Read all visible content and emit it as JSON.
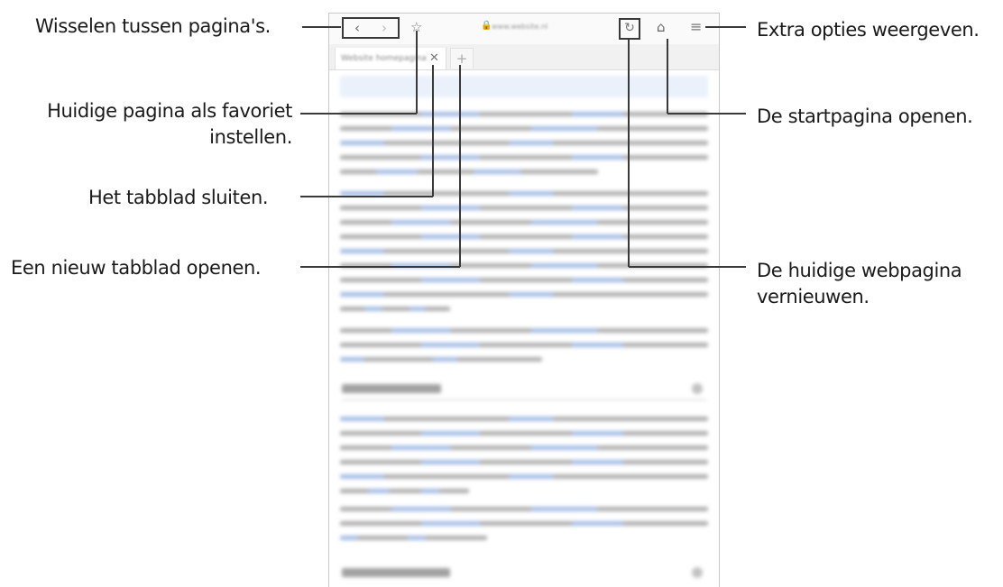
{
  "callouts": {
    "switch_pages": "Wisselen tussen pagina's.",
    "bookmark_line1": "Huidige pagina als favoriet",
    "bookmark_line2": "instellen.",
    "close_tab": "Het tabblad sluiten.",
    "new_tab": "Een nieuw tabblad openen.",
    "more_options": "Extra opties weergeven.",
    "home": "De startpagina openen.",
    "refresh_line1": "De huidige webpagina",
    "refresh_line2": "vernieuwen."
  },
  "browser": {
    "url": "www.website.nl",
    "tab_title": "Website homepagina",
    "icons": [
      "back-arrow-icon",
      "forward-arrow-icon",
      "star-icon",
      "lock-icon",
      "refresh-icon",
      "home-icon",
      "menu-icon",
      "close-icon",
      "plus-icon"
    ]
  }
}
